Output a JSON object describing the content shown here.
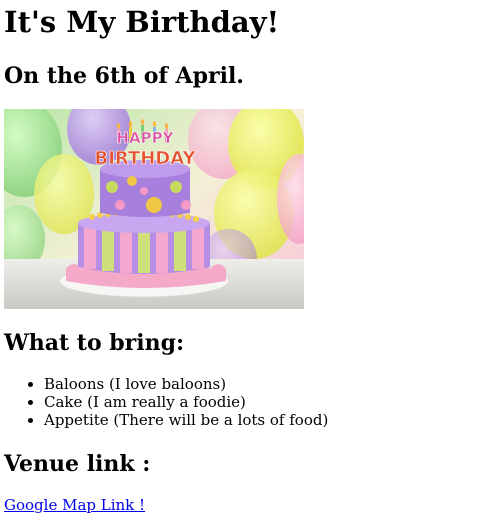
{
  "heading": "It's My Birthday!",
  "date_line": "On the 6th of April.",
  "image": {
    "cake_topper": "HAPPY BIRTHDAY"
  },
  "bring_heading": "What to bring:",
  "bring_items": [
    "Baloons (I love baloons)",
    "Cake (I am really a foodie)",
    "Appetite (There will be a lots of food)"
  ],
  "venue_heading": "Venue link :",
  "map_link_label": "Google Map Link !",
  "colors": {
    "link": "#0000ee",
    "text": "#000000"
  }
}
